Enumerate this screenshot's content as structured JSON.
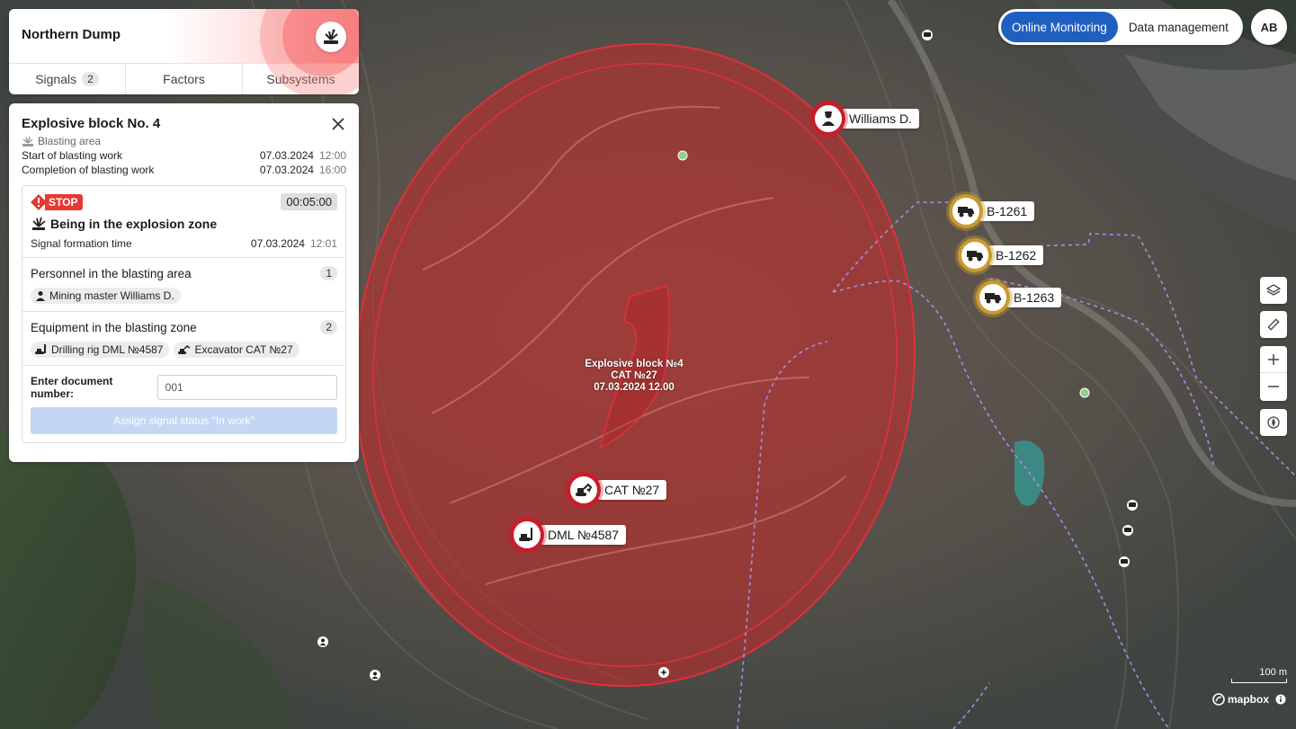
{
  "header": {
    "title": "Northern Dump",
    "tabs": [
      {
        "label": "Signals",
        "count": "2"
      },
      {
        "label": "Factors"
      },
      {
        "label": "Subsystems"
      }
    ]
  },
  "panel": {
    "title": "Explosive block No. 4",
    "subtitle": "Blasting area",
    "start_label": "Start of blasting work",
    "start_date": "07.03.2024",
    "start_time": "12:00",
    "end_label": "Completion of blasting work",
    "end_date": "07.03.2024",
    "end_time": "16:00",
    "signal": {
      "status": "STOP",
      "timer": "00:05:00",
      "title": "Being in the explosion zone",
      "formation_label": "Signal formation time",
      "formation_date": "07.03.2024",
      "formation_time": "12:01"
    },
    "personnel": {
      "label": "Personnel in the blasting area",
      "count": "1",
      "items": [
        "Mining master Williams D."
      ]
    },
    "equipment": {
      "label": "Equipment in the blasting zone",
      "count": "2",
      "items": [
        "Drilling rig DML №4587",
        "Excavator CAT №27"
      ]
    },
    "document": {
      "label": "Enter document number:",
      "value": "001"
    },
    "assign_button": "Assign signal status \"In work\""
  },
  "mode_toggle": {
    "active": "Online Monitoring",
    "inactive": "Data management"
  },
  "user_initials": "AB",
  "map": {
    "zone_label": [
      "Explosive block №4",
      "CAT №27",
      "07.03.2024 12.00"
    ],
    "markers": {
      "williams": "Williams D.",
      "cat": "CAT №27",
      "dml": "DML №4587",
      "b1261": "B-1261",
      "b1262": "B-1262",
      "b1263": "B-1263"
    },
    "scale": "100 m",
    "attribution": "mapbox"
  },
  "colors": {
    "danger": "#c91c2a",
    "warning_ring": "#c99a2e",
    "primary": "#1f5fbf",
    "route": "#a58ee8"
  }
}
